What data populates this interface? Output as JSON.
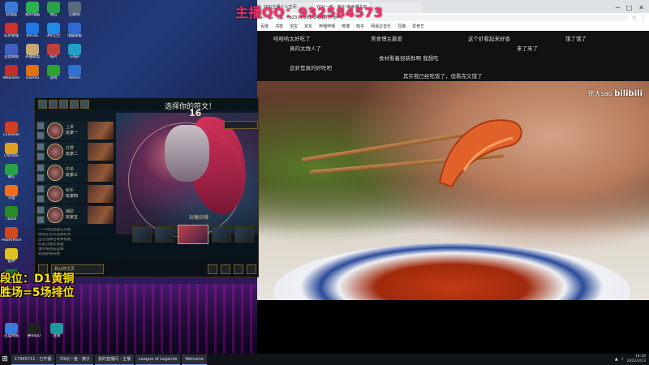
{
  "overlay": {
    "qq_banner": "主播QQ：932584573",
    "rank_line1": "段位：D1黄铜",
    "rank_line2": "胜场=5场排位"
  },
  "desktop": {
    "icons": [
      {
        "label": "此电脑",
        "icon": "computer-icon",
        "color": "#3a7bd5"
      },
      {
        "label": "我的电脑",
        "icon": "wechat-icon",
        "color": "#29b34a"
      },
      {
        "label": "微信",
        "icon": "folder-icon",
        "color": "#2aa04a"
      },
      {
        "label": "回收站",
        "icon": "recycle-bin-icon",
        "color": "#5b6b7c"
      },
      {
        "label": "任务管理",
        "icon": "tool-icon",
        "color": "#d03030"
      },
      {
        "label": "KuGou",
        "icon": "kugou-icon",
        "color": "#1e78e6"
      },
      {
        "label": "360卫士",
        "icon": "shield-icon",
        "color": "#1f8ee0"
      },
      {
        "label": "电脑管家",
        "icon": "tencent-icon",
        "color": "#2f6ad0"
      },
      {
        "label": "百度网盘",
        "icon": "box-icon",
        "color": "#4060c0"
      },
      {
        "label": "英雄联盟",
        "icon": "lol-icon",
        "color": "#c8aa6e"
      },
      {
        "label": "照片",
        "icon": "photo-icon",
        "color": "#c04040"
      },
      {
        "label": "Edge",
        "icon": "edge-icon",
        "color": "#1fa0c8"
      },
      {
        "label": "WeGame",
        "icon": "wegame-icon",
        "color": "#c03030"
      },
      {
        "label": "Garena",
        "icon": "garena-icon",
        "color": "#e07010"
      },
      {
        "label": "游戏",
        "icon": "game-icon",
        "color": "#30a030"
      },
      {
        "label": "Admin",
        "icon": "admin-icon",
        "color": "#3070d0"
      }
    ],
    "column_icons": [
      {
        "label": "CCleaner",
        "icon": "cleaner-icon",
        "color": "#d04020"
      },
      {
        "label": "Chrome",
        "icon": "chrome-icon",
        "color": "#e0a020"
      },
      {
        "label": "微信",
        "icon": "chat-icon",
        "color": "#2aa04a"
      },
      {
        "label": "斗鱼",
        "icon": "douyu-icon",
        "color": "#f07020"
      },
      {
        "label": "iTools",
        "icon": "itools-icon",
        "color": "#2a8a2a"
      },
      {
        "label": "PowerPoint",
        "icon": "ppt-icon",
        "color": "#d04a20"
      },
      {
        "label": "雷神",
        "icon": "thunder-icon",
        "color": "#e0c020"
      },
      {
        "label": "Excel",
        "icon": "excel-icon",
        "color": "#207a40"
      }
    ],
    "bottom_icons": [
      {
        "label": "百度网盘",
        "icon": "cloud-icon",
        "color": "#3b7bd8"
      },
      {
        "label": "腾讯QQ",
        "icon": "qq-icon",
        "color": "#222"
      },
      {
        "label": "连接",
        "icon": "network-icon",
        "color": "#1a9a9a"
      }
    ]
  },
  "lol": {
    "title": "选择你的符文！",
    "timer": "16",
    "skin_label": "封魔剑魂",
    "rune_page": "默认符文页",
    "team": [
      {
        "champion": "上单",
        "player": "玩家一"
      },
      {
        "champion": "打野",
        "player": "玩家二"
      },
      {
        "champion": "中单",
        "player": "玩家三"
      },
      {
        "champion": "射手",
        "player": "玩家四"
      },
      {
        "champion": "辅助",
        "player": "玩家五"
      }
    ],
    "chat": [
      "一一对应位置已分配",
      "你现在可以选择符文",
      "正在选择召唤师技能",
      "队友已锁定英雄",
      "请尽快完成选择",
      "对局即将开始"
    ]
  },
  "browser": {
    "tabs": [
      {
        "label": "YOQ主播个人空间",
        "active": false
      },
      {
        "label": "YOQ一盘 - 嫂子/美食博主的",
        "active": true
      },
      {
        "label": "",
        "active": false
      }
    ],
    "url": "b23.tv/BV1rU4y1D7F?p=1",
    "bookmarks": [
      "百度",
      "书签",
      "淘宝",
      "京东",
      "哔哩哔哩",
      "微博",
      "知乎",
      "网易云音乐",
      "豆瓣",
      "爱奇艺"
    ],
    "danmaku": [
      "哈哈哈太好吃了",
      "美食博主最爱",
      "这个虾看起来好香",
      "饿了饿了",
      "真的太馋人了",
      "食材看着很新鲜啊 我想吃",
      "来了来了",
      "这虾是真的好吃吧",
      "其实我已经吃饭了，但看完又饿了"
    ],
    "watermark_name": "徐大sao",
    "watermark_brand": "bilibili"
  },
  "taskbar": {
    "items": [
      "17945711 - 已开播",
      "YOQ(一盘 - 嫂子",
      "我的直播间 - 主播",
      "League of Legends",
      "Welcome"
    ],
    "time": "14:34",
    "date": "2022/3/13"
  }
}
